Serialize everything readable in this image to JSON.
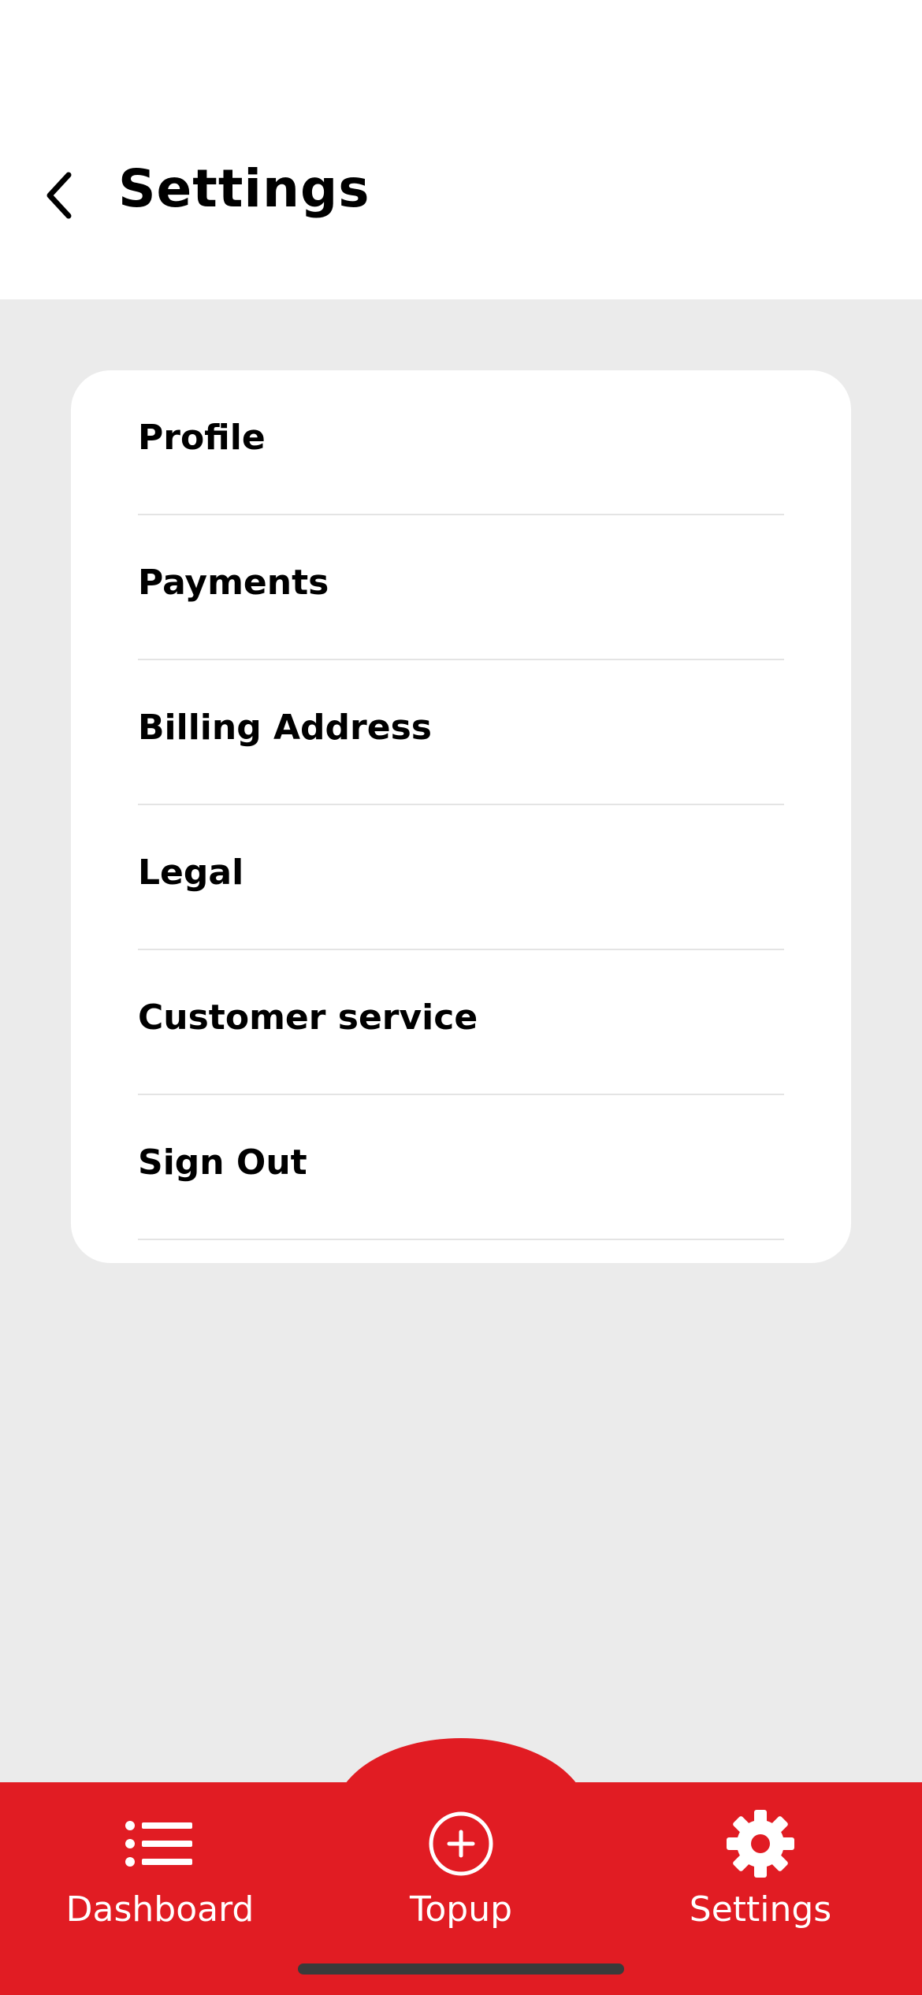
{
  "header": {
    "title": "Settings",
    "back_icon": "chevron-left-icon"
  },
  "menu": {
    "items": [
      {
        "label": "Profile"
      },
      {
        "label": "Payments"
      },
      {
        "label": "Billing Address"
      },
      {
        "label": "Legal"
      },
      {
        "label": "Customer service"
      },
      {
        "label": "Sign Out"
      }
    ]
  },
  "tabbar": {
    "accent_color": "#e11c23",
    "tabs": [
      {
        "label": "Dashboard",
        "icon": "list-icon"
      },
      {
        "label": "Topup",
        "icon": "plus-circle-icon"
      },
      {
        "label": "Settings",
        "icon": "gear-icon"
      }
    ]
  }
}
